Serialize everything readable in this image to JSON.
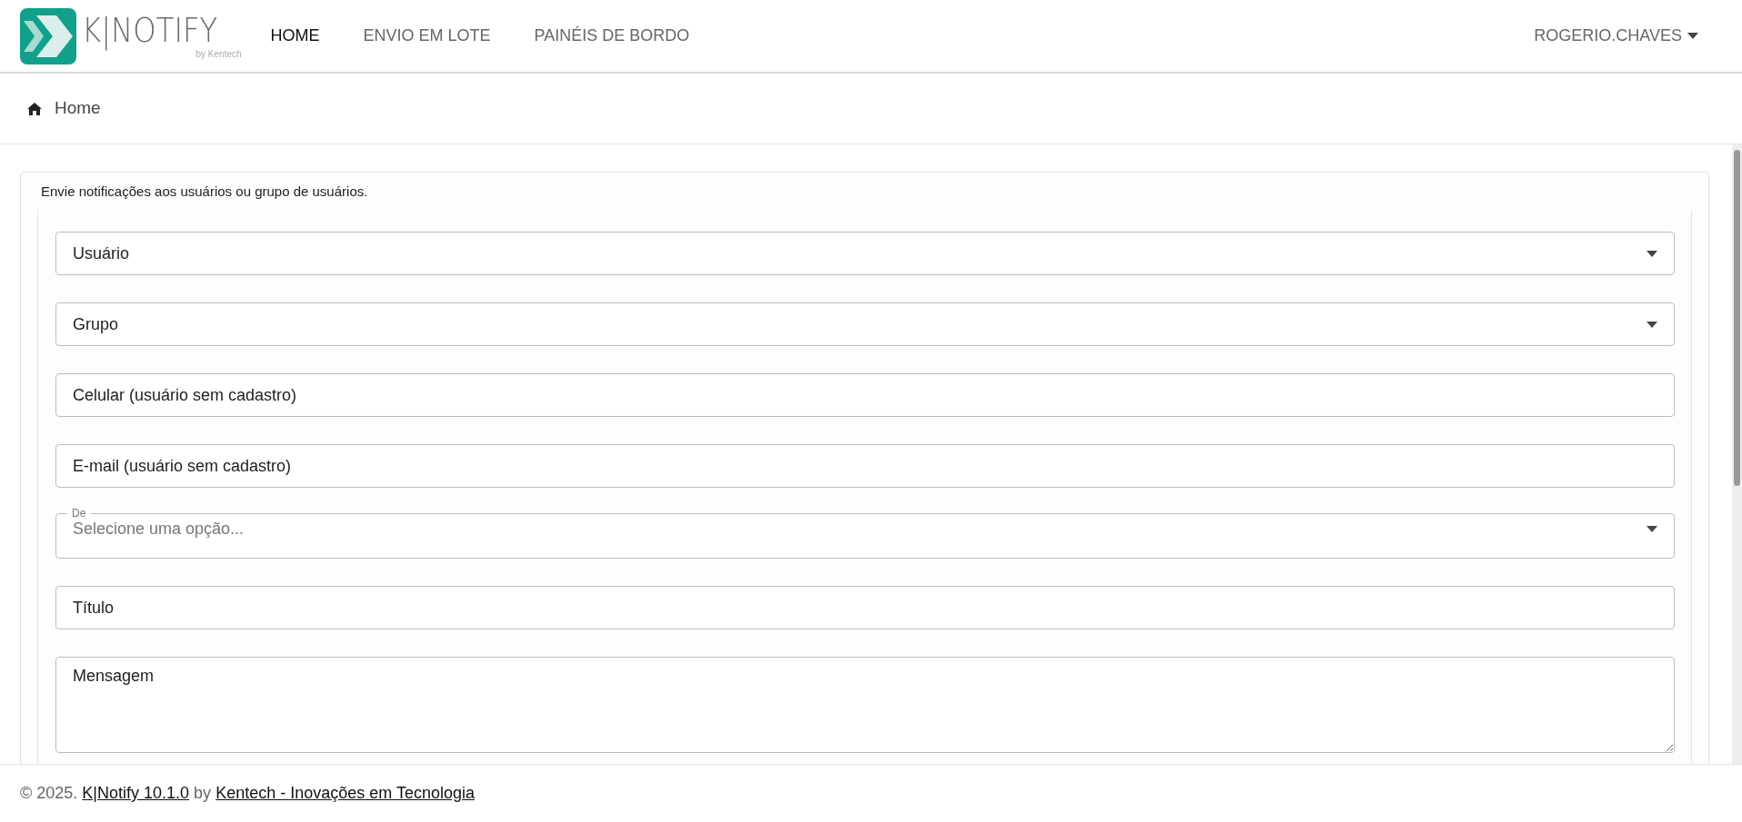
{
  "logo": {
    "name": "K|NOTIFY",
    "tagline": "by Kentech"
  },
  "nav": [
    {
      "label": "HOME",
      "selected": true
    },
    {
      "label": "ENVIO EM LOTE",
      "selected": false
    },
    {
      "label": "PAINÉIS DE BORDO",
      "selected": false
    }
  ],
  "user_menu": {
    "label": "ROGERIO.CHAVES"
  },
  "breadcrumb": [
    {
      "label": "Home"
    }
  ],
  "card": {
    "description": "Envie notificações aos usuários ou grupo de usuários.",
    "fields": [
      {
        "kind": "select",
        "label": "Usuário"
      },
      {
        "kind": "select",
        "label": "Grupo"
      },
      {
        "kind": "input",
        "placeholder": "Celular (usuário sem cadastro)"
      },
      {
        "kind": "input",
        "placeholder": "E-mail (usuário sem cadastro)"
      },
      {
        "kind": "select",
        "label": "De",
        "placeholder": "Selecione uma opção..."
      },
      {
        "kind": "input",
        "placeholder": "Título"
      },
      {
        "kind": "textarea",
        "placeholder": "Mensagem"
      }
    ]
  },
  "footer": {
    "copyright": "© 2025.",
    "product_link": "K|Notify 10.1.0",
    "by": "by",
    "company_link": "Kentech - Inovações em Tecnologia"
  }
}
